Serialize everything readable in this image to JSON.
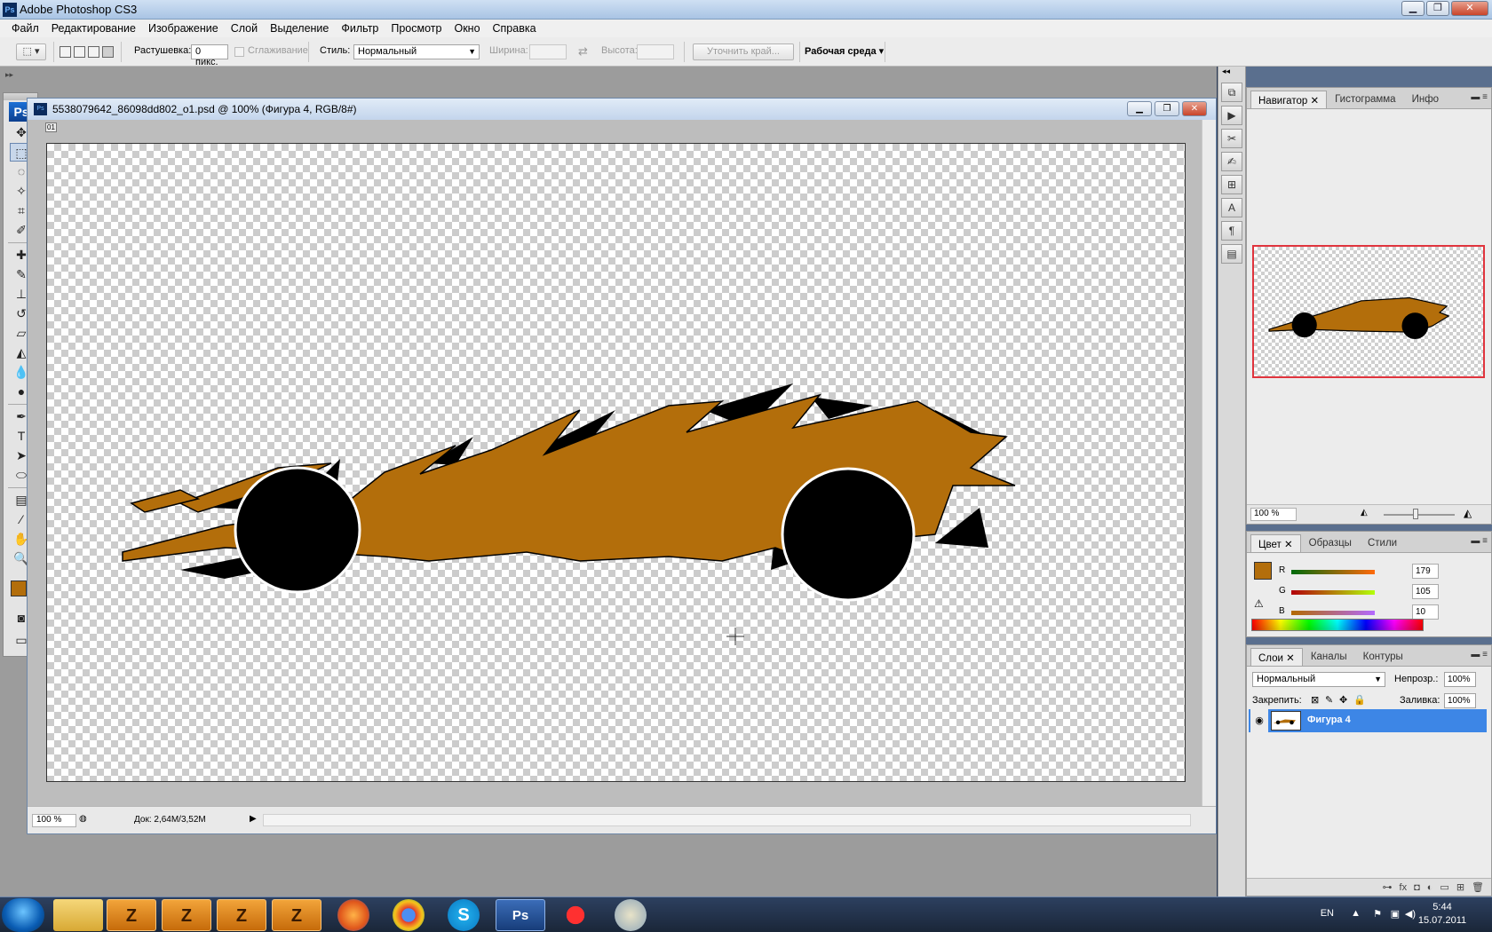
{
  "window": {
    "title": "Adobe Photoshop CS3",
    "app_icon": "Ps"
  },
  "menu": [
    "Файл",
    "Редактирование",
    "Изображение",
    "Слой",
    "Выделение",
    "Фильтр",
    "Просмотр",
    "Окно",
    "Справка"
  ],
  "options": {
    "feather_label": "Растушевка:",
    "feather_value": "0 пикс.",
    "antialias_label": "Сглаживание",
    "style_label": "Стиль:",
    "style_value": "Нормальный",
    "width_label": "Ширина:",
    "height_label": "Высота:",
    "refine_edge": "Уточнить край...",
    "workspace": "Рабочая среда ▾"
  },
  "document": {
    "title": "5538079642_86098dd802_o1.psd @ 100% (Фигура 4, RGB/8#)",
    "zoom": "100 %",
    "doc_info": "Док: 2,64M/3,52M",
    "corner_label": "01"
  },
  "navigator": {
    "tabs": [
      "Навигатор",
      "Гистограмма",
      "Инфо"
    ],
    "zoom": "100 %"
  },
  "color_panel": {
    "tabs": [
      "Цвет",
      "Образцы",
      "Стили"
    ],
    "channels": [
      {
        "label": "R",
        "value": "179"
      },
      {
        "label": "G",
        "value": "105"
      },
      {
        "label": "B",
        "value": "10"
      }
    ],
    "foreground": "#b36e0b"
  },
  "layers_panel": {
    "tabs": [
      "Слои",
      "Каналы",
      "Контуры"
    ],
    "blend_mode": "Нормальный",
    "opacity_label": "Непрозр.:",
    "opacity_value": "100%",
    "lock_label": "Закрепить:",
    "fill_label": "Заливка:",
    "fill_value": "100%",
    "layer_name": "Фигура 4"
  },
  "taskbar": {
    "language": "EN",
    "time": "5:44",
    "date": "15.07.2011",
    "z_label": "Z",
    "ps_label": "Ps"
  },
  "icons": [
    "search-icon",
    "move-icon",
    "marquee-icon",
    "lasso-icon",
    "magic-wand-icon",
    "crop-icon",
    "eyedropper-icon",
    "healing-icon",
    "brush-icon",
    "stamp-icon",
    "history-brush-icon",
    "eraser-icon",
    "bucket-icon",
    "blur-icon",
    "dodge-icon",
    "pen-icon",
    "type-icon",
    "path-select-icon",
    "shape-icon",
    "notes-icon",
    "hand-icon",
    "zoom-icon"
  ],
  "colors": {
    "accent": "#3d86e6",
    "car_body": "#b36e0b",
    "nav_frame": "#e0343d"
  }
}
